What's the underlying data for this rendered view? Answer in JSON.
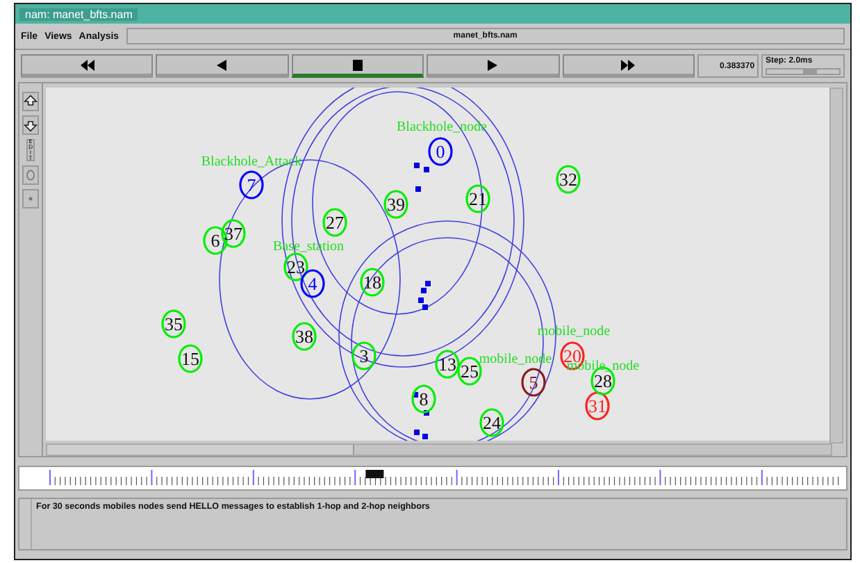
{
  "window": {
    "title": "nam: manet_bfts.nam"
  },
  "menu": [
    "File",
    "Views",
    "Analysis"
  ],
  "file_name": "manet_bfts.nam",
  "playback": [
    {
      "kind": "rewind",
      "selected": false
    },
    {
      "kind": "back",
      "selected": false
    },
    {
      "kind": "stop",
      "selected": true
    },
    {
      "kind": "play",
      "selected": false
    },
    {
      "kind": "forward",
      "selected": false
    }
  ],
  "time": "0.383370",
  "step": {
    "label": "Step: 2.0ms",
    "level": 0.6
  },
  "tools": [
    {
      "kind": "zoom-in"
    },
    {
      "kind": "zoom-out"
    },
    {
      "kind": "edit",
      "label": "EDIT"
    },
    {
      "kind": "oval"
    },
    {
      "kind": "dot"
    }
  ],
  "labels": [
    "Blackhole_node",
    "Blackhole_Attack",
    "Base_station",
    "mobile_node",
    "mobile_node",
    "mobile_node"
  ],
  "nodes": [
    {
      "id": "0",
      "color": "#0000ff"
    },
    {
      "id": "7",
      "color": "#0000ff"
    },
    {
      "id": "32",
      "color": "#00ee00"
    },
    {
      "id": "21",
      "color": "#00ee00"
    },
    {
      "id": "39",
      "color": "#00ee00"
    },
    {
      "id": "27",
      "color": "#00ee00"
    },
    {
      "id": "6",
      "color": "#00ee00"
    },
    {
      "id": "37",
      "color": "#00ee00"
    },
    {
      "id": "23",
      "color": "#00ee00"
    },
    {
      "id": "4",
      "color": "#0000ff"
    },
    {
      "id": "18",
      "color": "#00ee00"
    },
    {
      "id": "35",
      "color": "#00ee00"
    },
    {
      "id": "15",
      "color": "#00ee00"
    },
    {
      "id": "38",
      "color": "#00ee00"
    },
    {
      "id": "3",
      "color": "#00ee00"
    },
    {
      "id": "13",
      "color": "#00ee00"
    },
    {
      "id": "25",
      "color": "#00ee00"
    },
    {
      "id": "20",
      "color": "#ff2020"
    },
    {
      "id": "5",
      "color": "#8b1a1a"
    },
    {
      "id": "31",
      "color": "#ff2020"
    },
    {
      "id": "28",
      "color": "#00ee00"
    },
    {
      "id": "8",
      "color": "#00ee00"
    },
    {
      "id": "24",
      "color": "#00ee00"
    }
  ],
  "timeline": {
    "level": 0.41
  },
  "status": "For 30 seconds mobiles nodes send HELLO messages to establish 1-hop and 2-hop neighbors"
}
